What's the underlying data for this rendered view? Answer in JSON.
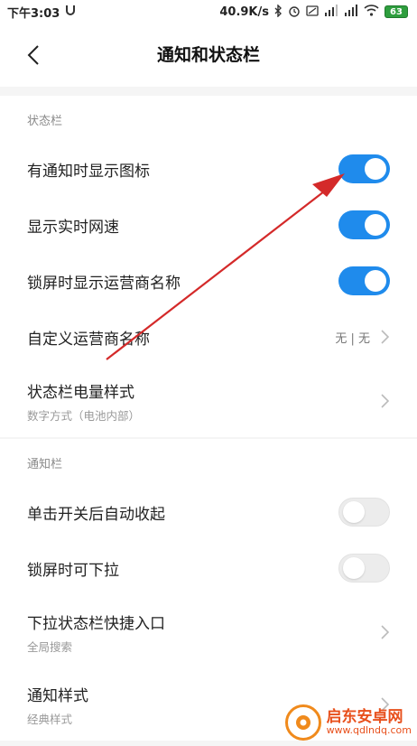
{
  "statusbar": {
    "time": "下午3:03",
    "network_speed": "40.9K/s",
    "battery": "63"
  },
  "title": "通知和状态栏",
  "sections": [
    {
      "header": "状态栏",
      "rows": [
        {
          "label": "有通知时显示图标",
          "toggle": true
        },
        {
          "label": "显示实时网速",
          "toggle": true
        },
        {
          "label": "锁屏时显示运营商名称",
          "toggle": true
        },
        {
          "label": "自定义运营商名称",
          "value": "无 | 无",
          "chevron": true
        },
        {
          "label": "状态栏电量样式",
          "sub": "数字方式（电池内部）",
          "chevron": true
        }
      ]
    },
    {
      "header": "通知栏",
      "rows": [
        {
          "label": "单击开关后自动收起",
          "toggle": false
        },
        {
          "label": "锁屏时可下拉",
          "toggle": false
        },
        {
          "label": "下拉状态栏快捷入口",
          "sub": "全局搜索",
          "chevron": true
        },
        {
          "label": "通知样式",
          "sub": "经典样式",
          "chevron": true
        }
      ]
    }
  ],
  "watermark": {
    "title": "启东安卓网",
    "url": "www.qdlndq.com"
  },
  "colors": {
    "accent": "#1f8bec",
    "annotation_arrow": "#d42a2a"
  }
}
